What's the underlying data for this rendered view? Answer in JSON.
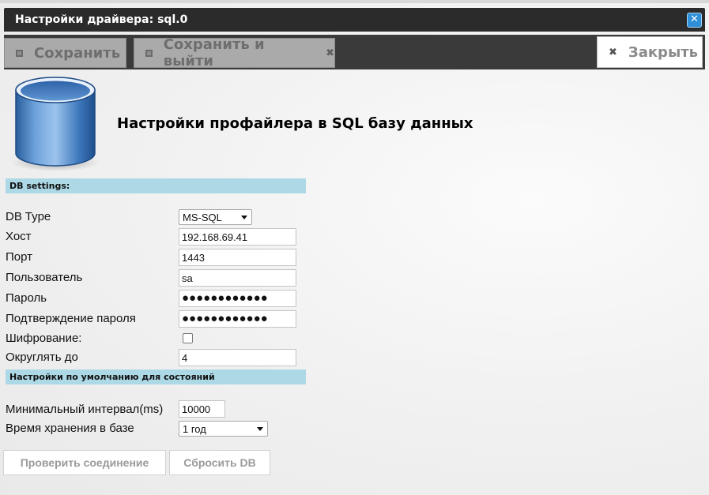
{
  "window": {
    "title": "Настройки драйвера: sql.0"
  },
  "toolbar": {
    "save_label": "Сохранить",
    "save_exit_label": "Сохранить и выйти",
    "close_label": "Закрыть"
  },
  "header": {
    "title": "Настройки профайлера в SQL базу данных"
  },
  "sections": {
    "db_settings": "DB settings:",
    "state_defaults": "Настройки по умолчанию для состояний"
  },
  "form": {
    "db_type": {
      "label": "DB Type",
      "value": "MS-SQL"
    },
    "host": {
      "label": "Хост",
      "value": "192.168.69.41"
    },
    "port": {
      "label": "Порт",
      "value": "1443"
    },
    "user": {
      "label": "Пользователь",
      "value": "sa"
    },
    "password": {
      "label": "Пароль",
      "value": "●●●●●●●●●●●●"
    },
    "password_confirm": {
      "label": "Подтверждение пароля",
      "value": "●●●●●●●●●●●●"
    },
    "encryption": {
      "label": "Шифрование:",
      "checked": false
    },
    "round": {
      "label": "Округлять до",
      "value": "4"
    },
    "min_interval": {
      "label": "Минимальный интервал(ms)",
      "value": "10000"
    },
    "retention": {
      "label": "Время хранения в базе",
      "value": "1 год"
    }
  },
  "buttons": {
    "test_connection": "Проверить соединение",
    "reset_db": "Сбросить DB"
  },
  "colors": {
    "section_header": "#add8e6",
    "titlebar": "#2b2b2b",
    "close_button": "#2f8fd8"
  }
}
